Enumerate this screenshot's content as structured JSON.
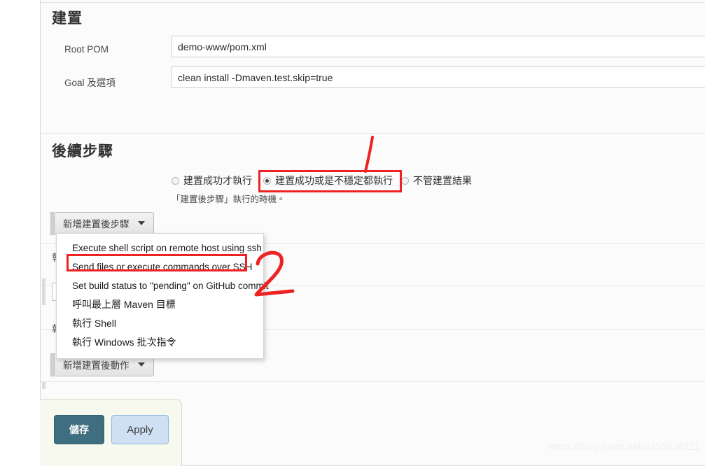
{
  "build_section": {
    "heading": "建置",
    "fields": [
      {
        "label": "Root POM",
        "value": "demo-www/pom.xml",
        "placeholder": ""
      },
      {
        "label": "Goal 及選項",
        "value": "clean install -Dmaven.test.skip=true",
        "placeholder": ""
      }
    ]
  },
  "post_steps_section": {
    "heading": "後續步驟",
    "radio_options": [
      {
        "label": "建置成功才執行",
        "checked": false
      },
      {
        "label": "建置成功或是不穩定都執行",
        "checked": true
      },
      {
        "label": "不管建置結果",
        "checked": false
      }
    ],
    "hint": "「建置後步驟」執行的時機。",
    "add_post_step_button": "新增建置後步驟",
    "add_post_action_button": "新增建置後動作",
    "dropdown_items": [
      "Execute shell script on remote host using ssh",
      "Send files or execute commands over SSH",
      "Set build status to \"pending\" on GitHub commit",
      "呼叫最上層 Maven 目標",
      "執行 Shell",
      "執行 Windows 批次指令"
    ],
    "highlighted_dropdown_index": 1
  },
  "footer": {
    "save_label": "儲存",
    "apply_label": "Apply"
  },
  "annotations": [
    {
      "name": "step-1-marker",
      "text": "1"
    },
    {
      "name": "step-2-marker",
      "text": "2"
    }
  ],
  "watermark": "https://blog.csdn.net/a251628111",
  "colors": {
    "annotation_red": "#ee2222",
    "save_button": "#3e6e80",
    "apply_button": "#cfe0f4",
    "panel_background": "#fbfbfb",
    "save_bar_background": "#f7f9ef"
  }
}
